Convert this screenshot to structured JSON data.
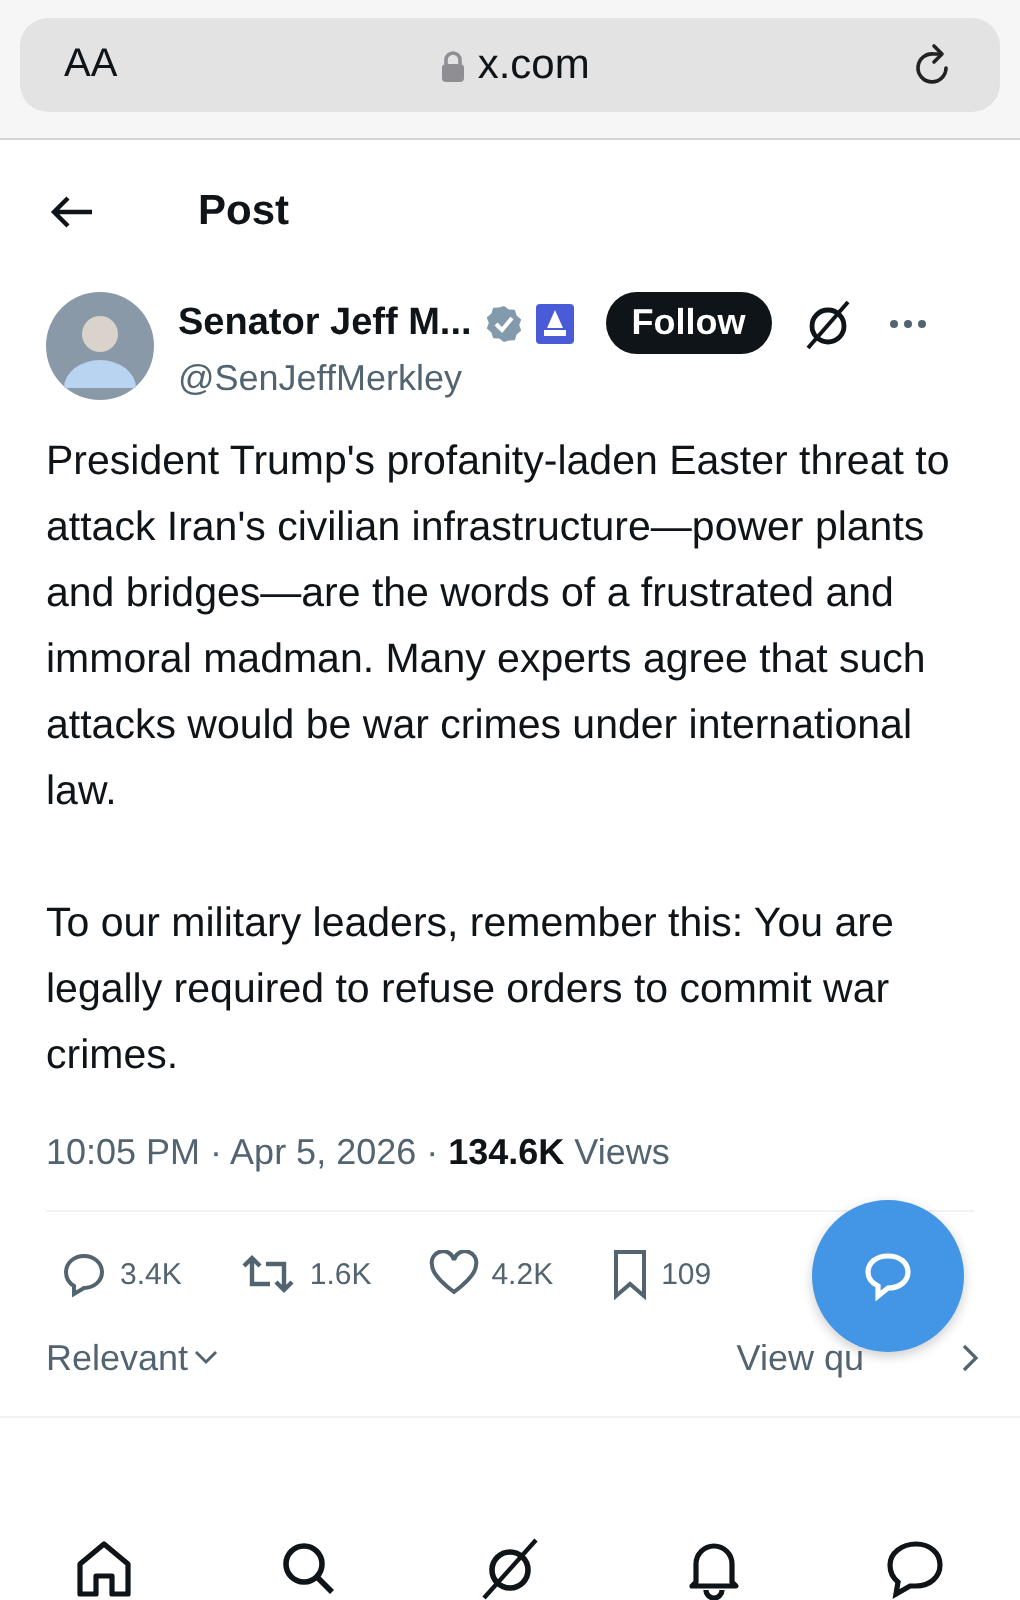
{
  "browser": {
    "text_size": "AA",
    "address": "x.com"
  },
  "header": {
    "title": "Post"
  },
  "author": {
    "name": "Senator Jeff M...",
    "handle": "@SenJeffMerkley",
    "follow": "Follow"
  },
  "post": {
    "paragraphs": [
      "President Trump's profanity-laden Easter threat to attack Iran's civilian infrastructure—power plants and bridges—are the words of a frustrated and immoral madman. Many experts agree that such attacks would be war crimes under international law.",
      "To our military leaders, remember this: You are legally required to refuse orders to commit war crimes."
    ],
    "meta": "10:05 PM · Apr 5, 2026 · **134.6K** Views"
  },
  "actions": [
    {
      "kind": "reply",
      "count": "3.4K"
    },
    {
      "kind": "repost",
      "count": "1.6K"
    },
    {
      "kind": "like",
      "count": "4.2K"
    },
    {
      "kind": "bookmark",
      "count": "109"
    }
  ],
  "sort": {
    "label": "Relevant"
  },
  "quotes": {
    "label": "View qu"
  },
  "nav": [
    {
      "kind": "home",
      "selected": false
    },
    {
      "kind": "search",
      "selected": false
    },
    {
      "kind": "grok",
      "selected": false
    },
    {
      "kind": "notifications",
      "selected": false
    },
    {
      "kind": "messages",
      "selected": false
    }
  ]
}
